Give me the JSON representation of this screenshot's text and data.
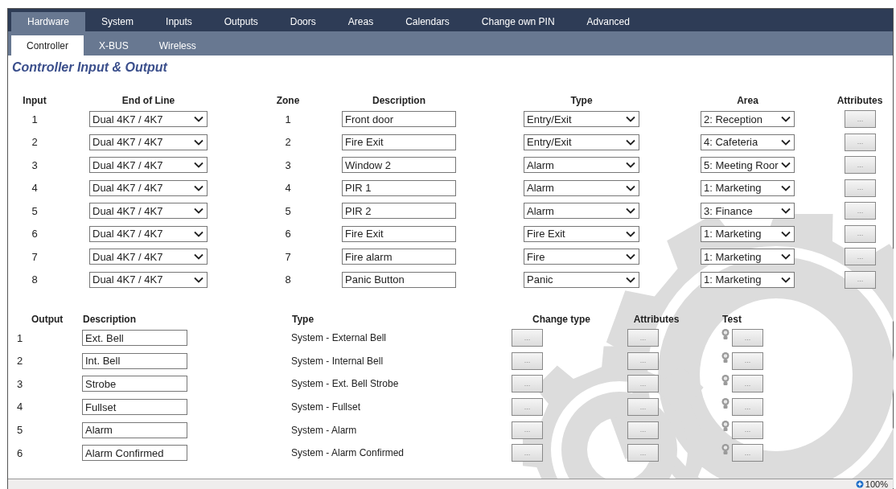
{
  "nav_tabs": [
    {
      "label": "Hardware",
      "selected": true
    },
    {
      "label": "System",
      "selected": false
    },
    {
      "label": "Inputs",
      "selected": false
    },
    {
      "label": "Outputs",
      "selected": false
    },
    {
      "label": "Doors",
      "selected": false
    },
    {
      "label": "Areas",
      "selected": false
    },
    {
      "label": "Calendars",
      "selected": false
    },
    {
      "label": "Change own PIN",
      "selected": false
    },
    {
      "label": "Advanced",
      "selected": false
    }
  ],
  "sub_tabs": [
    {
      "label": "Controller",
      "selected": true
    },
    {
      "label": "X-BUS",
      "selected": false
    },
    {
      "label": "Wireless",
      "selected": false
    }
  ],
  "title": "Controller Input & Output",
  "inputs_table": {
    "columns": [
      "Input",
      "End of Line",
      "Zone",
      "Description",
      "Type",
      "Area",
      "Attributes"
    ],
    "rows": [
      {
        "input": "1",
        "end_of_line": "Dual 4K7 / 4K7",
        "zone": "1",
        "description": "Front door",
        "type": "Entry/Exit",
        "area": "2: Reception",
        "attributes_button": "..."
      },
      {
        "input": "2",
        "end_of_line": "Dual 4K7 / 4K7",
        "zone": "2",
        "description": "Fire Exit",
        "type": "Entry/Exit",
        "area": "4: Cafeteria",
        "attributes_button": "..."
      },
      {
        "input": "3",
        "end_of_line": "Dual 4K7 / 4K7",
        "zone": "3",
        "description": "Window 2",
        "type": "Alarm",
        "area": "5: Meeting Roor",
        "attributes_button": "..."
      },
      {
        "input": "4",
        "end_of_line": "Dual 4K7 / 4K7",
        "zone": "4",
        "description": "PIR 1",
        "type": "Alarm",
        "area": "1: Marketing",
        "attributes_button": "..."
      },
      {
        "input": "5",
        "end_of_line": "Dual 4K7 / 4K7",
        "zone": "5",
        "description": "PIR 2",
        "type": "Alarm",
        "area": "3: Finance",
        "attributes_button": "..."
      },
      {
        "input": "6",
        "end_of_line": "Dual 4K7 / 4K7",
        "zone": "6",
        "description": "Fire Exit",
        "type": "Fire Exit",
        "area": "1: Marketing",
        "attributes_button": "..."
      },
      {
        "input": "7",
        "end_of_line": "Dual 4K7 / 4K7",
        "zone": "7",
        "description": "Fire alarm",
        "type": "Fire",
        "area": "1: Marketing",
        "attributes_button": "..."
      },
      {
        "input": "8",
        "end_of_line": "Dual 4K7 / 4K7",
        "zone": "8",
        "description": "Panic Button",
        "type": "Panic",
        "area": "1: Marketing",
        "attributes_button": "..."
      }
    ]
  },
  "outputs_table": {
    "columns": [
      "Output",
      "Description",
      "Type",
      "Change type",
      "Attributes",
      "Test"
    ],
    "rows": [
      {
        "output": "1",
        "description": "Ext. Bell",
        "type": "System - External Bell",
        "change_type_button": "...",
        "attributes_button": "...",
        "test_button": "..."
      },
      {
        "output": "2",
        "description": "Int. Bell",
        "type": "System - Internal Bell",
        "change_type_button": "...",
        "attributes_button": "...",
        "test_button": "..."
      },
      {
        "output": "3",
        "description": "Strobe",
        "type": "System - Ext. Bell Strobe",
        "change_type_button": "...",
        "attributes_button": "...",
        "test_button": "..."
      },
      {
        "output": "4",
        "description": "Fullset",
        "type": "System - Fullset",
        "change_type_button": "...",
        "attributes_button": "...",
        "test_button": "..."
      },
      {
        "output": "5",
        "description": "Alarm",
        "type": "System - Alarm",
        "change_type_button": "...",
        "attributes_button": "...",
        "test_button": "..."
      },
      {
        "output": "6",
        "description": "Alarm Confirmed",
        "type": "System - Alarm Confirmed",
        "change_type_button": "...",
        "attributes_button": "...",
        "test_button": "..."
      }
    ]
  },
  "status_bar": {
    "zoom": "100%"
  }
}
